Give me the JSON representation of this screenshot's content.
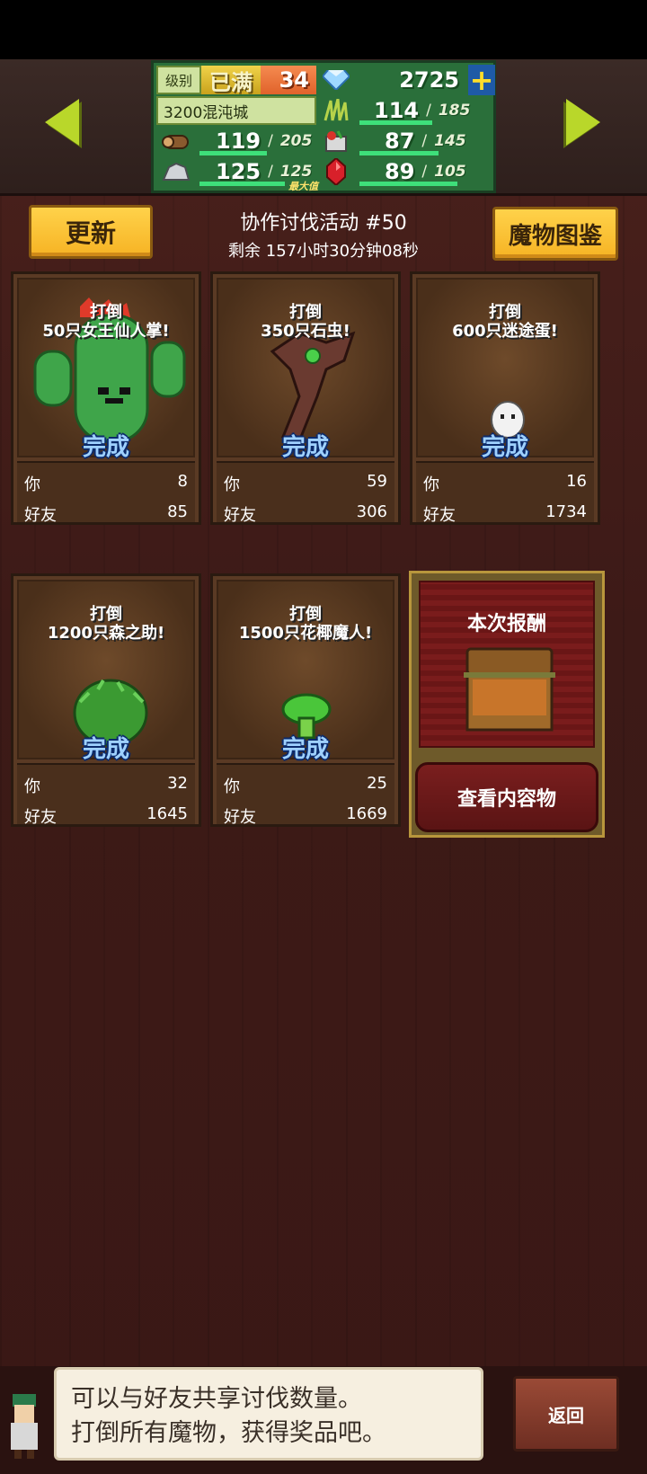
{
  "stats": {
    "level_label": "级别",
    "level_max": "已满",
    "level_value": "34",
    "gems": "2725",
    "town": "3200混沌城",
    "grass_value": "114",
    "grass_max": "185",
    "wood_value": "119",
    "wood_max": "205",
    "food_value": "87",
    "food_max": "145",
    "ore_value": "125",
    "ore_max": "125",
    "ore_tag": "最大值",
    "crystal_value": "89",
    "crystal_max": "105"
  },
  "header": {
    "refresh_label": "更新",
    "event_title": "协作讨伐活动 #50",
    "remaining": "剩余 157小时30分钟08秒",
    "bestiary_label": "魔物图鉴"
  },
  "cards": [
    {
      "line1": "打倒",
      "line2": "50只女王仙人掌!",
      "status": "完成",
      "you_label": "你",
      "you": "8",
      "friends_label": "好友",
      "friends": "85"
    },
    {
      "line1": "打倒",
      "line2": "350只石虫!",
      "status": "完成",
      "you_label": "你",
      "you": "59",
      "friends_label": "好友",
      "friends": "306"
    },
    {
      "line1": "打倒",
      "line2": "600只迷途蛋!",
      "status": "完成",
      "you_label": "你",
      "you": "16",
      "friends_label": "好友",
      "friends": "1734"
    },
    {
      "line1": "打倒",
      "line2": "1200只森之助!",
      "status": "完成",
      "you_label": "你",
      "you": "32",
      "friends_label": "好友",
      "friends": "1645"
    },
    {
      "line1": "打倒",
      "line2": "1500只花椰魔人!",
      "status": "完成",
      "you_label": "你",
      "you": "25",
      "friends_label": "好友",
      "friends": "1669"
    }
  ],
  "reward": {
    "title": "本次报酬",
    "view_button": "查看内容物"
  },
  "footer": {
    "tip_line1": "可以与好友共享讨伐数量。",
    "tip_line2": "打倒所有魔物，获得奖品吧。",
    "back_label": "返回"
  },
  "colors": {
    "accent_green": "#b9d72a",
    "button_yellow": "#ffd24a",
    "done_blue": "#9fd1ff"
  }
}
